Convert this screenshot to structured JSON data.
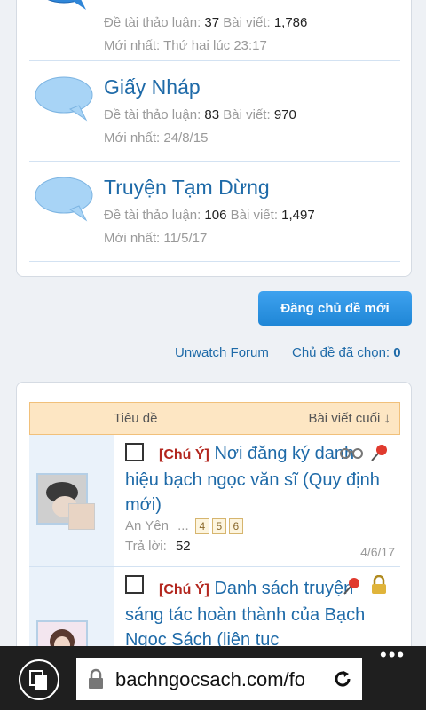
{
  "forums": [
    {
      "title": "",
      "stats_threads_label": "Đề tài thảo luận:",
      "threads": "37",
      "stats_posts_label": "Bài viết:",
      "posts": "1,786",
      "latest": "Mới nhất: Thứ hai lúc 23:17"
    },
    {
      "title": "Giấy Nháp",
      "stats_threads_label": "Đề tài thảo luận:",
      "threads": "83",
      "stats_posts_label": "Bài viết:",
      "posts": "970",
      "latest": "Mới nhất: 24/8/15"
    },
    {
      "title": "Truyện Tạm Dừng",
      "stats_threads_label": "Đề tài thảo luận:",
      "threads": "106",
      "stats_posts_label": "Bài viết:",
      "posts": "1,497",
      "latest": "Mới nhất: 11/5/17"
    }
  ],
  "actions": {
    "new_thread": "Đăng chủ đề mới",
    "unwatch": "Unwatch Forum",
    "selected_label": "Chủ đề đã chọn:",
    "selected_count": "0"
  },
  "thread_header": {
    "title_col": "Tiêu đề",
    "last_post_col": "Bài viết cuối ↓"
  },
  "threads": [
    {
      "prefix": "[Chú Ý]",
      "title": "Nơi đăng ký danh hiệu bạch ngọc văn sĩ (Quy định mới)",
      "author": "An Yên",
      "ellipsis": "...",
      "pages": [
        "4",
        "5",
        "6"
      ],
      "replies_label": "Trả lời:",
      "replies": "52",
      "last_post_date": "4/6/17"
    },
    {
      "prefix": "[Chú Ý]",
      "title": "Danh sách truyện sáng tác hoàn thành của Bạch Ngọc Sách (liên tục"
    }
  ],
  "browser": {
    "url": "bachngocsach.com/fo",
    "more": "•••"
  },
  "colors": {
    "link": "#1e6aa8",
    "prefix": "#b3261e",
    "button": "#2a8fdc",
    "header_bg": "#fde6c3"
  }
}
